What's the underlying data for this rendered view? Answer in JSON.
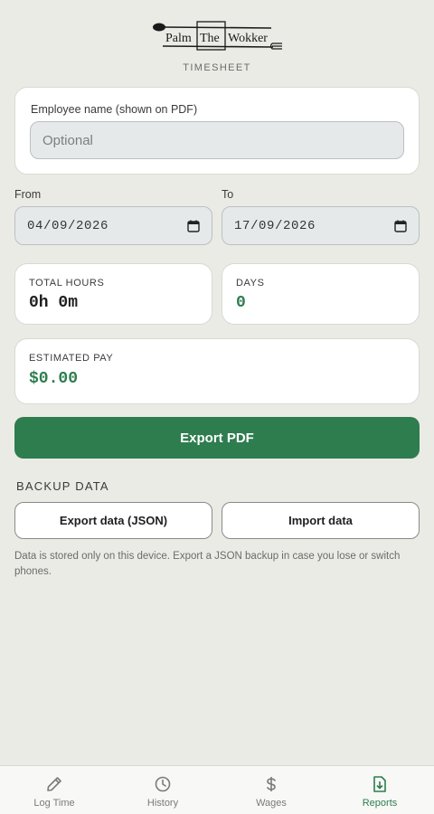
{
  "app": {
    "logo_text": "Palm The Wokker",
    "subtitle": "TIMESHEET"
  },
  "employee": {
    "label": "Employee name (shown on PDF)",
    "placeholder": "Optional",
    "value": ""
  },
  "range": {
    "from_label": "From",
    "from_value": "04/09/2026",
    "to_label": "To",
    "to_value": "17/09/2026"
  },
  "stats": {
    "total_hours_label": "TOTAL HOURS",
    "total_hours_value": "0h 0m",
    "days_label": "DAYS",
    "days_value": "0",
    "estimated_pay_label": "ESTIMATED PAY",
    "estimated_pay_value": "$0.00"
  },
  "actions": {
    "export_pdf_label": "Export PDF"
  },
  "backup": {
    "title": "BACKUP DATA",
    "export_json_label": "Export data (JSON)",
    "import_label": "Import data",
    "note": "Data is stored only on this device. Export a JSON backup in case you lose or switch phones."
  },
  "tabs": [
    {
      "label": "Log Time",
      "icon": "pencil-icon",
      "active": false
    },
    {
      "label": "History",
      "icon": "clock-icon",
      "active": false
    },
    {
      "label": "Wages",
      "icon": "dollar-icon",
      "active": false
    },
    {
      "label": "Reports",
      "icon": "document-download-icon",
      "active": true
    }
  ],
  "colors": {
    "accent": "#2e7d4f",
    "background": "#ebebe5",
    "card": "#ffffff",
    "input": "#e6e9ea",
    "muted_text": "#6b6b6b"
  }
}
